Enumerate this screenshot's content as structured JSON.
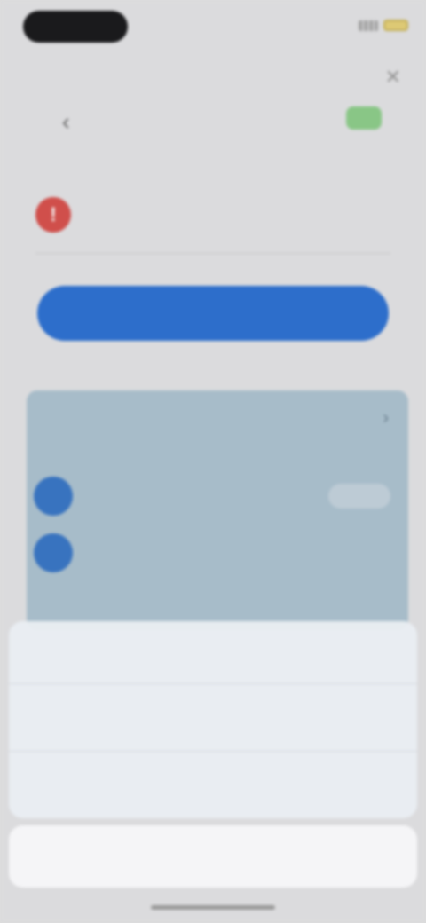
{
  "status_bar": {
    "time": "",
    "battery_color": "#e7d27a"
  },
  "header": {
    "title": "",
    "close_icon": "close-icon",
    "nav_title": "",
    "nav_subtitle": ""
  },
  "warning": {
    "icon": "alert-icon",
    "text": "",
    "color": "#d9534f"
  },
  "primary_button": {
    "label": "",
    "color": "#2f73d4"
  },
  "card": {
    "title": "",
    "subtitle": "",
    "link": "",
    "items": [
      {
        "text": ""
      },
      {
        "text": ""
      }
    ],
    "footer": ""
  },
  "action_sheet": {
    "message": "",
    "options": [
      {
        "label": ""
      },
      {
        "label": ""
      }
    ],
    "cancel_label": "",
    "accent": "#3a84e8"
  }
}
